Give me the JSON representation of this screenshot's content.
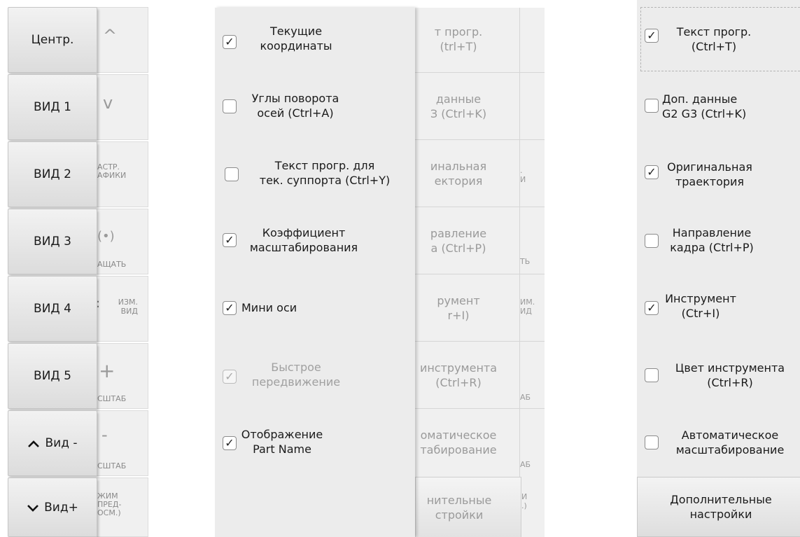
{
  "left_panel": {
    "view_buttons": [
      {
        "label": "Центр.",
        "arrow": ""
      },
      {
        "label": "ВИД 1",
        "arrow": ""
      },
      {
        "label": "ВИД 2",
        "arrow": ""
      },
      {
        "label": "ВИД 3",
        "arrow": ""
      },
      {
        "label": "ВИД 4",
        "arrow": ""
      },
      {
        "label": "ВИД 5",
        "arrow": ""
      },
      {
        "label": "Вид -",
        "arrow": "^"
      },
      {
        "label": "Вид+",
        "arrow": "v"
      }
    ],
    "background_cells": [
      {
        "icon": "^",
        "text": ""
      },
      {
        "icon": "v",
        "text": ""
      },
      {
        "icon": "",
        "text": "АСТР.\nАФИКИ"
      },
      {
        "icon": "(•)",
        "text": "АЩАТЬ"
      },
      {
        "icon": ":",
        "text": "ИЗМ.\nВИД"
      },
      {
        "icon": "+",
        "text": "СШТАБ"
      },
      {
        "icon": "-",
        "text": "СШТАБ"
      },
      {
        "icon": "",
        "text": "ЖИМ\nПРЕД-\nОСМ.)"
      }
    ]
  },
  "middle_panel": {
    "options": [
      {
        "label": "Текущие\nкоординаты",
        "checked": true,
        "disabled": false
      },
      {
        "label": "Углы поворота\nосей (Ctrl+A)",
        "checked": false,
        "disabled": false
      },
      {
        "label": "Текст прогр. для\nтек. суппорта (Ctrl+Y)",
        "checked": false,
        "disabled": false
      },
      {
        "label": "Коэффициент\nмасштабирования",
        "checked": true,
        "disabled": false
      },
      {
        "label": "Мини оси",
        "checked": true,
        "disabled": false
      },
      {
        "label": "Быстрое\nпередвижение",
        "checked": true,
        "disabled": true
      },
      {
        "label": "Отображение\nPart Name",
        "checked": true,
        "disabled": false
      }
    ],
    "background_fragments": [
      "т прогр.\n(trl+T)",
      "данные\nЗ (Ctrl+K)",
      "инальная\nектория",
      "равление\nа (Ctrl+P)",
      "румент\nr+I)",
      "инструмента\n(Ctrl+R)",
      "оматическое\nтабирование",
      "нительные\nстройки"
    ],
    "background_side_fragments": [
      ".\nИ",
      "ТЬ",
      "ИМ.\nИД",
      "АБ",
      "АБ",
      "И\n.)"
    ]
  },
  "right_panel": {
    "options": [
      {
        "label": "Текст прогр.\n(Ctrl+T)",
        "checked": true
      },
      {
        "label": "Доп. данные\nG2 G3 (Ctrl+K)",
        "checked": false
      },
      {
        "label": "Оригинальная\nтраектория",
        "checked": true
      },
      {
        "label": "Направление\nкадра (Ctrl+P)",
        "checked": false
      },
      {
        "label": "Инструмент\n(Ctr+I)",
        "checked": true
      },
      {
        "label": "Цвет инструмента\n(Ctrl+R)",
        "checked": false
      },
      {
        "label": "Автоматическое\nмасштабирование",
        "checked": false
      }
    ],
    "more_settings_label": "Дополнительные\nнастройки"
  },
  "colors": {
    "panel": "#ececec",
    "button": "#e6e6e6",
    "disabled_text": "#a0a0a0"
  }
}
